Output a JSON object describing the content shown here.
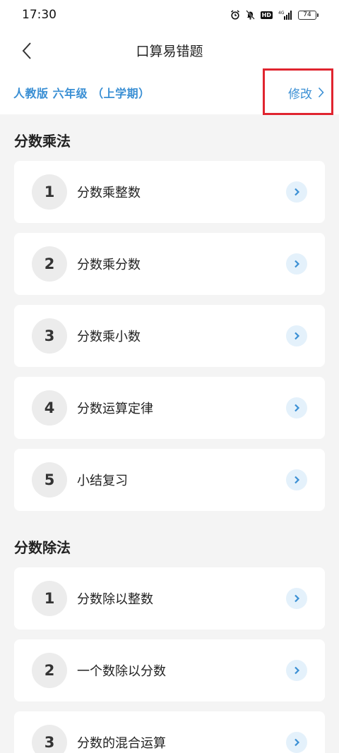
{
  "status_bar": {
    "time": "17:30",
    "network": "4G",
    "hd": "HD",
    "battery": "74"
  },
  "nav": {
    "title": "口算易错题"
  },
  "edition": {
    "label": "人教版 六年级 （上学期）",
    "edit_label": "修改"
  },
  "colors": {
    "accent": "#3a8fd4",
    "highlight": "#e0242f",
    "badge_bg": "#ececec",
    "chevron_bg": "#e4f1fb"
  },
  "sections": [
    {
      "title": "分数乘法",
      "items": [
        {
          "num": "1",
          "label": "分数乘整数"
        },
        {
          "num": "2",
          "label": "分数乘分数"
        },
        {
          "num": "3",
          "label": "分数乘小数"
        },
        {
          "num": "4",
          "label": "分数运算定律"
        },
        {
          "num": "5",
          "label": "小结复习"
        }
      ]
    },
    {
      "title": "分数除法",
      "items": [
        {
          "num": "1",
          "label": "分数除以整数"
        },
        {
          "num": "2",
          "label": "一个数除以分数"
        },
        {
          "num": "3",
          "label": "分数的混合运算"
        }
      ]
    }
  ]
}
